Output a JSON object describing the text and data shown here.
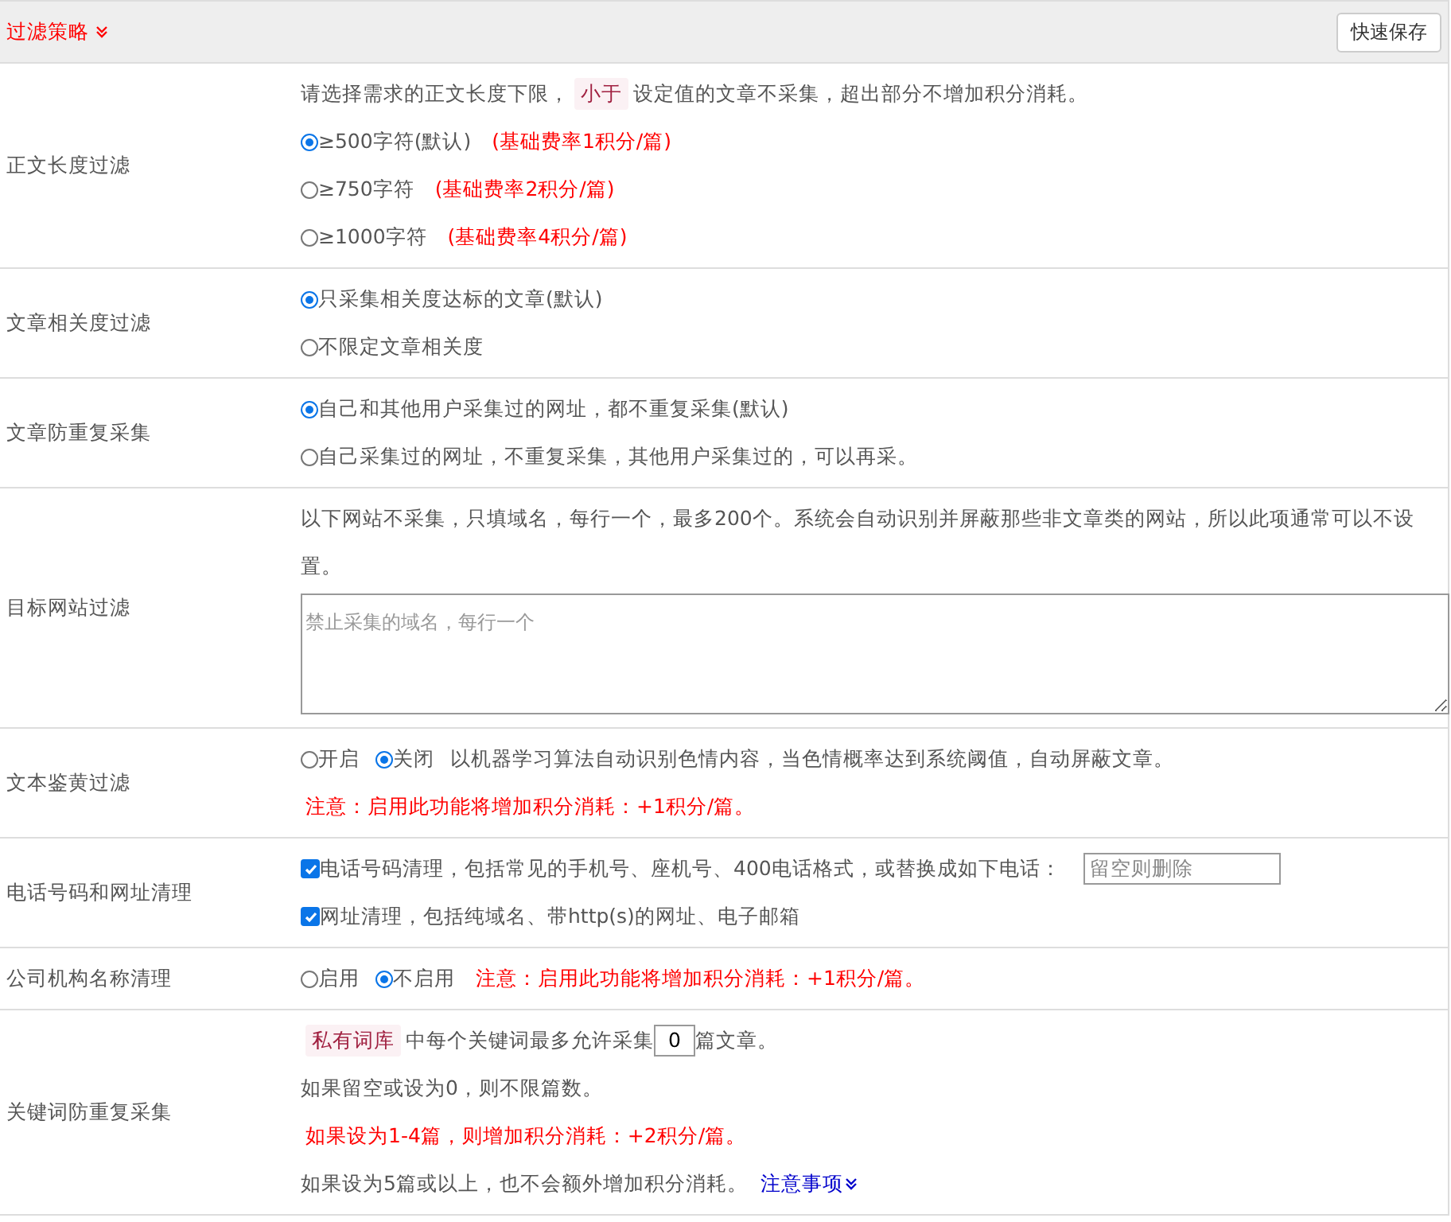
{
  "header": {
    "title": "过滤策略",
    "save_button": "快速保存"
  },
  "rows": [
    {
      "label": "正文长度过滤",
      "lines": [
        [
          {
            "kind": "text",
            "text": "请选择需求的正文长度下限，"
          },
          {
            "kind": "tag",
            "text": "小于"
          },
          {
            "kind": "text",
            "text": "设定值的文章不采集，超出部分不增加积分消耗。"
          }
        ],
        [
          {
            "kind": "radio",
            "label": "≥500字符(默认)",
            "selected": true
          },
          {
            "kind": "warn",
            "text": "(基础费率1积分/篇)"
          }
        ],
        [
          {
            "kind": "radio",
            "label": "≥750字符",
            "selected": false
          },
          {
            "kind": "warn",
            "text": "(基础费率2积分/篇)"
          }
        ],
        [
          {
            "kind": "radio",
            "label": "≥1000字符",
            "selected": false
          },
          {
            "kind": "warn",
            "text": "(基础费率4积分/篇)"
          }
        ]
      ]
    },
    {
      "label": "文章相关度过滤",
      "lines": [
        [
          {
            "kind": "radio",
            "label": "只采集相关度达标的文章(默认)",
            "selected": true
          }
        ],
        [
          {
            "kind": "radio",
            "label": "不限定文章相关度",
            "selected": false
          }
        ]
      ]
    },
    {
      "label": "文章防重复采集",
      "lines": [
        [
          {
            "kind": "radio",
            "label": "自己和其他用户采集过的网址，都不重复采集(默认)",
            "selected": true
          }
        ],
        [
          {
            "kind": "radio",
            "label": "自己采集过的网址，不重复采集，其他用户采集过的，可以再采。",
            "selected": false
          }
        ]
      ]
    },
    {
      "label": "目标网站过滤",
      "lines": [
        [
          {
            "kind": "text",
            "text": "以下网站不采集，只填域名，每行一个，最多200个。系统会自动识别并屏蔽那些非文章类的网站，所以此项通常可以不设置。"
          }
        ],
        [
          {
            "kind": "area",
            "placeholder": "禁止采集的域名，每行一个"
          }
        ]
      ]
    },
    {
      "label": "文本鉴黄过滤",
      "lines": [
        [
          {
            "kind": "radio",
            "label": "开启",
            "selected": false
          },
          {
            "kind": "radio",
            "label": "关闭",
            "selected": true
          },
          {
            "kind": "text",
            "text": "以机器学习算法自动识别色情内容，当色情概率达到系统阈值，自动屏蔽文章。"
          }
        ],
        [
          {
            "kind": "warn",
            "text": "注意：启用此功能将增加积分消耗：+1积分/篇。"
          }
        ]
      ]
    },
    {
      "label": "电话号码和网址清理",
      "lines": [
        [
          {
            "kind": "check",
            "label": "电话号码清理，包括常见的手机号、座机号、400电话格式，或替换成如下电话：",
            "checked": true
          },
          {
            "kind": "field",
            "placeholder": "留空则删除"
          }
        ],
        [
          {
            "kind": "check",
            "label": "网址清理，包括纯域名、带http(s)的网址、电子邮箱",
            "checked": true
          }
        ]
      ]
    },
    {
      "label": "公司机构名称清理",
      "lines": [
        [
          {
            "kind": "radio",
            "label": "启用",
            "selected": false
          },
          {
            "kind": "radio",
            "label": "不启用",
            "selected": true
          },
          {
            "kind": "warn",
            "text": "注意：启用此功能将增加积分消耗：+1积分/篇。"
          }
        ]
      ]
    },
    {
      "label": "关键词防重复采集",
      "lines": [
        [
          {
            "kind": "tag",
            "text": "私有词库"
          },
          {
            "kind": "text",
            "text": "中每个关键词最多允许采集"
          },
          {
            "kind": "number",
            "value": "0"
          },
          {
            "kind": "text",
            "text": "篇文章。"
          }
        ],
        [
          {
            "kind": "text",
            "text": "如果留空或设为0，则不限篇数。"
          }
        ],
        [
          {
            "kind": "warn",
            "text": "如果设为1-4篇，则增加积分消耗：+2积分/篇。"
          }
        ],
        [
          {
            "kind": "text",
            "text": "如果设为5篇或以上，也不会额外增加积分消耗。"
          },
          {
            "kind": "link",
            "text": "注意事项"
          }
        ]
      ]
    }
  ]
}
